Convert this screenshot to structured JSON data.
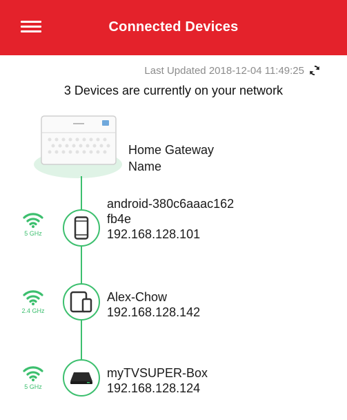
{
  "header": {
    "title": "Connected Devices",
    "menu_icon": "hamburger-menu-icon"
  },
  "status": {
    "last_updated": "Last Updated 2018-12-04 11:49:25",
    "summary": "3 Devices are currently on your network",
    "refresh_icon": "refresh-icon"
  },
  "gateway": {
    "name_line1": "Home Gateway",
    "name_line2": "Name"
  },
  "devices": [
    {
      "name_line1": "android-380c6aaac162",
      "name_line2": "fb4e",
      "ip": "192.168.128.101",
      "band": "5 GHz",
      "icon": "smartphone-icon"
    },
    {
      "name_line1": "Alex-Chow",
      "ip": "192.168.128.142",
      "band": "2.4 GHz",
      "icon": "tablet-phone-icon"
    },
    {
      "name_line1": "myTVSUPER-Box",
      "ip": "192.168.128.124",
      "band": "5 GHz",
      "icon": "set-top-box-icon"
    }
  ],
  "colors": {
    "accent_red": "#e4222b",
    "connection_green": "#3cbf6e"
  }
}
